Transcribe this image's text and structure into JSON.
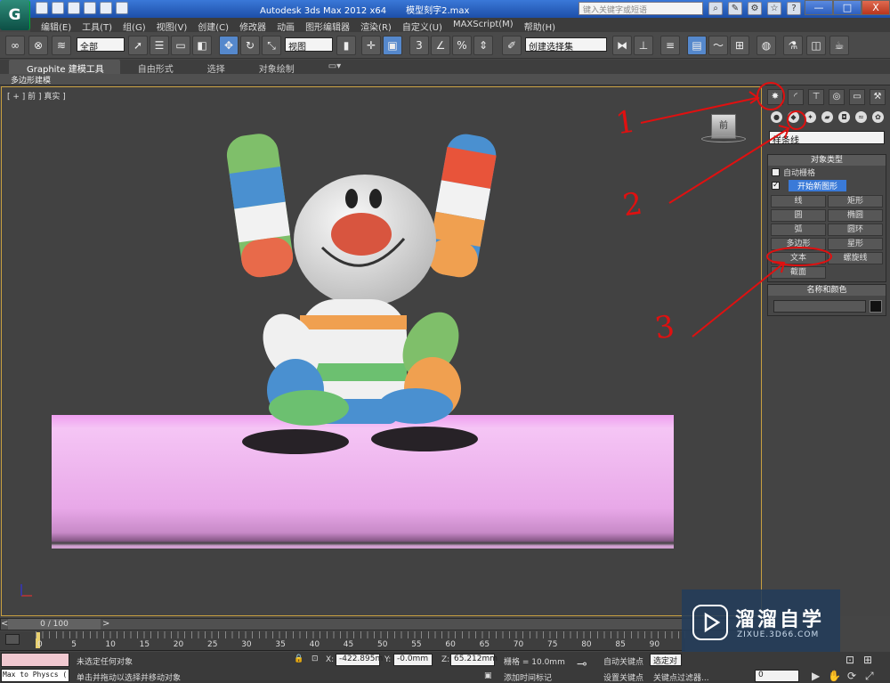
{
  "window": {
    "app": "Autodesk 3ds Max 2012 x64",
    "file": "模型刻字2.max",
    "search_placeholder": "键入关键字或短语",
    "minimize": "—",
    "maximize": "□",
    "close": "X"
  },
  "app_icon_letter": "G",
  "menu": [
    "编辑(E)",
    "工具(T)",
    "组(G)",
    "视图(V)",
    "创建(C)",
    "修改器",
    "动画",
    "图形编辑器",
    "渲染(R)",
    "自定义(U)",
    "MAXScript(M)",
    "帮助(H)"
  ],
  "toolbar": {
    "selection_filter": "全部",
    "ref_coord": "视图",
    "named_selection": "创建选择集"
  },
  "ribbon": {
    "tabs": [
      "Graphite 建模工具",
      "自由形式",
      "选择",
      "对象绘制"
    ],
    "sub_label": "多边形建模"
  },
  "viewport": {
    "label": "[ + ] 前 ] 真实 ]",
    "viewcube_label": "前"
  },
  "command_panel": {
    "category_dropdown": "样条线",
    "object_type": {
      "header": "对象类型",
      "autogrid": "自动栅格",
      "start_new_shape": "开始新图形",
      "buttons": [
        "线",
        "矩形",
        "圆",
        "椭圆",
        "弧",
        "圆环",
        "多边形",
        "星形",
        "文本",
        "螺旋线",
        "截面"
      ]
    },
    "name_color": {
      "header": "名称和颜色",
      "color": "#111111"
    }
  },
  "annotations": [
    "1",
    "2",
    "3"
  ],
  "timeline": {
    "frame": "0 / 100",
    "ticks": [
      "0",
      "5",
      "10",
      "15",
      "20",
      "25",
      "30",
      "35",
      "40",
      "45",
      "50",
      "55",
      "60",
      "65",
      "70",
      "75",
      "80",
      "85",
      "90"
    ]
  },
  "status": {
    "maxscript": "Max to Physcs (",
    "selection": "未选定任何对象",
    "prompt": "单击并拖动以选择并移动对象",
    "x_label": "X:",
    "x": "-422.895m",
    "y_label": "Y:",
    "y": "-0.0mm",
    "z_label": "Z:",
    "z": "65.212mm",
    "grid": "栅格 = 10.0mm",
    "autokey": "自动关键点",
    "autokey_sel": "选定对象",
    "setkey": "设置关键点",
    "keyfilter": "关键点过滤器...",
    "add_time_tag": "添加时间标记",
    "frame_field": "0"
  },
  "watermark": {
    "cn": "溜溜自学",
    "en": "ZIXUE.3D66.COM"
  }
}
